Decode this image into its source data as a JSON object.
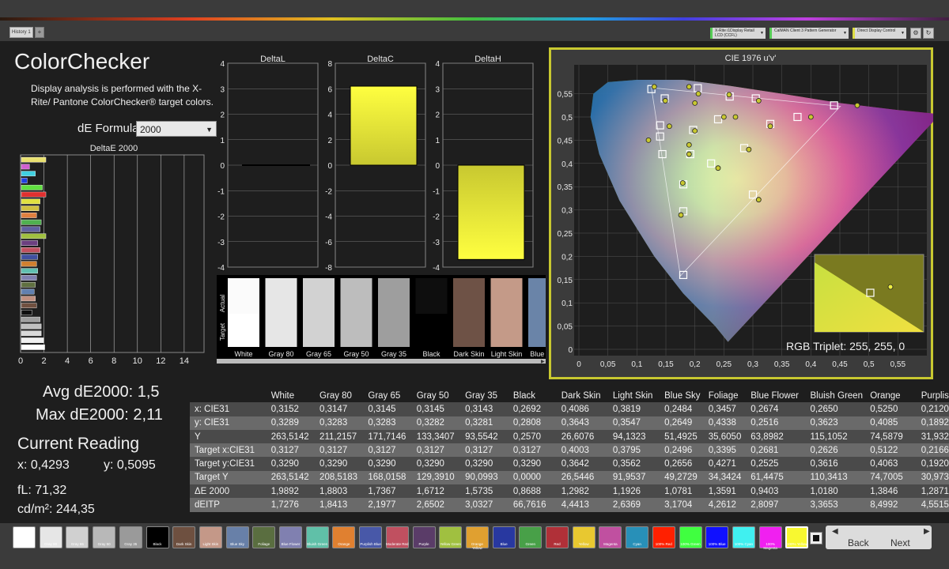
{
  "app": {
    "tab_label": "History 1",
    "dropdowns": [
      "X-Rite i1Display Retail LCD (CCFL)",
      "CalMAN Client 3 Pattern Generator",
      "Direct Display Control"
    ]
  },
  "page": {
    "title": "ColorChecker",
    "description": "Display analysis is performed with the X-Rite/ Pantone ColorChecker® target colors.",
    "formula_label": "dE Formula:",
    "formula_value": "2000"
  },
  "deltae_chart": {
    "title": "DeltaE 2000",
    "xticks": [
      "0",
      "2",
      "4",
      "6",
      "8",
      "10",
      "12",
      "14"
    ],
    "bars": [
      {
        "value": 2.1,
        "color": "#e8e070"
      },
      {
        "value": 0.7,
        "color": "#d060d0"
      },
      {
        "value": 1.2,
        "color": "#40d0e0"
      },
      {
        "value": 0.5,
        "color": "#2040e0"
      },
      {
        "value": 1.8,
        "color": "#60e040"
      },
      {
        "value": 2.1,
        "color": "#e03030"
      },
      {
        "value": 1.6,
        "color": "#e0e040"
      },
      {
        "value": 1.5,
        "color": "#d0c040"
      },
      {
        "value": 1.3,
        "color": "#e08040"
      },
      {
        "value": 1.7,
        "color": "#50b050"
      },
      {
        "value": 1.6,
        "color": "#6060a0"
      },
      {
        "value": 2.1,
        "color": "#a0c040"
      },
      {
        "value": 1.4,
        "color": "#6b3f7f"
      },
      {
        "value": 1.6,
        "color": "#c05060"
      },
      {
        "value": 1.4,
        "color": "#4050a0"
      },
      {
        "value": 1.3,
        "color": "#d08030"
      },
      {
        "value": 1.4,
        "color": "#60c0b0"
      },
      {
        "value": 1.3,
        "color": "#8080b0"
      },
      {
        "value": 1.2,
        "color": "#607040"
      },
      {
        "value": 1.1,
        "color": "#6080b0"
      },
      {
        "value": 1.2,
        "color": "#c09080"
      },
      {
        "value": 1.3,
        "color": "#705040"
      },
      {
        "value": 0.9,
        "color": "#101010"
      },
      {
        "value": 1.6,
        "color": "#a0a0a0"
      },
      {
        "value": 1.7,
        "color": "#c0c0c0"
      },
      {
        "value": 1.7,
        "color": "#d8d8d8"
      },
      {
        "value": 1.9,
        "color": "#f0f0f0"
      },
      {
        "value": 2.0,
        "color": "#ffffff"
      }
    ]
  },
  "delta_panels": [
    {
      "title": "DeltaL",
      "yticks": [
        "4",
        "3",
        "2",
        "1",
        "0",
        "-1",
        "-2",
        "-3",
        "-4"
      ],
      "ymax": 4,
      "value": 0.0
    },
    {
      "title": "DeltaC",
      "yticks": [
        "8",
        "6",
        "4",
        "2",
        "0",
        "-2",
        "-4",
        "-6",
        "-8"
      ],
      "ymax": 8,
      "value": 6.2
    },
    {
      "title": "DeltaH",
      "yticks": [
        "4",
        "3",
        "2",
        "1",
        "0",
        "-1",
        "-2",
        "-3",
        "-4"
      ],
      "ymax": 4,
      "value": -3.7
    }
  ],
  "swatch_strip": {
    "actual_label": "Actual",
    "target_label": "Target",
    "items": [
      {
        "name": "White",
        "actual": "#fbfbfb",
        "target": "#ffffff"
      },
      {
        "name": "Gray 80",
        "actual": "#e6e6e6",
        "target": "#e6e6e6"
      },
      {
        "name": "Gray 65",
        "actual": "#d2d2d2",
        "target": "#d2d2d2"
      },
      {
        "name": "Gray 50",
        "actual": "#bdbdbd",
        "target": "#bdbdbd"
      },
      {
        "name": "Gray 35",
        "actual": "#9e9e9e",
        "target": "#9e9e9e"
      },
      {
        "name": "Black",
        "actual": "#0e0e0e",
        "target": "#000000"
      },
      {
        "name": "Dark Skin",
        "actual": "#6e5246",
        "target": "#6e5246"
      },
      {
        "name": "Light Skin",
        "actual": "#c49a88",
        "target": "#c49a88"
      },
      {
        "name": "Blue Sky",
        "actual": "#6a84a8",
        "target": "#6a84a8"
      }
    ]
  },
  "cie": {
    "title": "CIE 1976 u'v'",
    "xticks": [
      "0",
      "0,05",
      "0,1",
      "0,15",
      "0,2",
      "0,25",
      "0,3",
      "0,35",
      "0,4",
      "0,45",
      "0,5",
      "0,55"
    ],
    "yticks": [
      "0,55",
      "0,5",
      "0,45",
      "0,4",
      "0,35",
      "0,3",
      "0,25",
      "0,2",
      "0,15",
      "0,1",
      "0,05",
      "0"
    ],
    "rgb_triplet": "RGB Triplet: 255, 255, 0",
    "targets": [
      [
        0.125,
        0.56
      ],
      [
        0.148,
        0.54
      ],
      [
        0.205,
        0.562
      ],
      [
        0.26,
        0.544
      ],
      [
        0.305,
        0.54
      ],
      [
        0.44,
        0.525
      ],
      [
        0.377,
        0.5
      ],
      [
        0.33,
        0.485
      ],
      [
        0.24,
        0.495
      ],
      [
        0.197,
        0.472
      ],
      [
        0.14,
        0.482
      ],
      [
        0.14,
        0.458
      ],
      [
        0.144,
        0.42
      ],
      [
        0.192,
        0.42
      ],
      [
        0.285,
        0.433
      ],
      [
        0.228,
        0.4
      ],
      [
        0.18,
        0.355
      ],
      [
        0.3,
        0.333
      ],
      [
        0.18,
        0.297
      ],
      [
        0.18,
        0.16
      ]
    ],
    "measured": [
      [
        0.13,
        0.565
      ],
      [
        0.149,
        0.535
      ],
      [
        0.206,
        0.55
      ],
      [
        0.259,
        0.548
      ],
      [
        0.31,
        0.535
      ],
      [
        0.48,
        0.525
      ],
      [
        0.4,
        0.5
      ],
      [
        0.33,
        0.48
      ],
      [
        0.25,
        0.5
      ],
      [
        0.2,
        0.47
      ],
      [
        0.156,
        0.48
      ],
      [
        0.12,
        0.45
      ],
      [
        0.19,
        0.42
      ],
      [
        0.19,
        0.44
      ],
      [
        0.293,
        0.43
      ],
      [
        0.24,
        0.39
      ],
      [
        0.179,
        0.358
      ],
      [
        0.31,
        0.322
      ],
      [
        0.176,
        0.289
      ],
      [
        0.19,
        0.565
      ],
      [
        0.2,
        0.53
      ],
      [
        0.27,
        0.5
      ]
    ]
  },
  "stats": {
    "avg": "Avg dE2000: 1,5",
    "max": "Max dE2000: 2,11",
    "current_title": "Current Reading",
    "x": "x: 0,4293",
    "y": "y: 0,5095",
    "fl": "fL: 71,32",
    "cdm2": "cd/m²: 244,35"
  },
  "table": {
    "columns": [
      "",
      "White",
      "Gray 80",
      "Gray 65",
      "Gray 50",
      "Gray 35",
      "Black",
      "Dark Skin",
      "Light Skin",
      "Blue Sky",
      "Foliage",
      "Blue Flower",
      "Bluish Green",
      "Orange",
      "Purplis"
    ],
    "rows": [
      [
        "x: CIE31",
        "0,3152",
        "0,3147",
        "0,3145",
        "0,3145",
        "0,3143",
        "0,2692",
        "0,4086",
        "0,3819",
        "0,2484",
        "0,3457",
        "0,2674",
        "0,2650",
        "0,5250",
        "0,2120"
      ],
      [
        "y: CIE31",
        "0,3289",
        "0,3283",
        "0,3283",
        "0,3282",
        "0,3281",
        "0,2808",
        "0,3643",
        "0,3547",
        "0,2649",
        "0,4338",
        "0,2516",
        "0,3623",
        "0,4085",
        "0,1892"
      ],
      [
        "Y",
        "263,5142",
        "211,2157",
        "171,7146",
        "133,3407",
        "93,5542",
        "0,2570",
        "26,6076",
        "94,1323",
        "51,4925",
        "35,6050",
        "63,8982",
        "115,1052",
        "74,5879",
        "31,932"
      ],
      [
        "Target x:CIE31",
        "0,3127",
        "0,3127",
        "0,3127",
        "0,3127",
        "0,3127",
        "0,3127",
        "0,4003",
        "0,3795",
        "0,2496",
        "0,3395",
        "0,2681",
        "0,2626",
        "0,5122",
        "0,2166"
      ],
      [
        "Target y:CIE31",
        "0,3290",
        "0,3290",
        "0,3290",
        "0,3290",
        "0,3290",
        "0,3290",
        "0,3642",
        "0,3562",
        "0,2656",
        "0,4271",
        "0,2525",
        "0,3616",
        "0,4063",
        "0,1920"
      ],
      [
        "Target Y",
        "263,5142",
        "208,5183",
        "168,0158",
        "129,3910",
        "90,0993",
        "0,0000",
        "26,5446",
        "91,9537",
        "49,2729",
        "34,3424",
        "61,4475",
        "110,3413",
        "74,7005",
        "30,973"
      ],
      [
        "ΔE 2000",
        "1,9892",
        "1,8803",
        "1,7367",
        "1,6712",
        "1,5735",
        "0,8688",
        "1,2982",
        "1,1926",
        "1,0781",
        "1,3591",
        "0,9403",
        "1,0180",
        "1,3846",
        "1,2871"
      ],
      [
        "dEITP",
        "1,7276",
        "1,8413",
        "2,1977",
        "2,6502",
        "3,0327",
        "66,7616",
        "4,4413",
        "2,6369",
        "3,1704",
        "4,2612",
        "2,8097",
        "3,3653",
        "8,4992",
        "4,5515"
      ]
    ]
  },
  "bottom_swatches": [
    {
      "label": "White",
      "color": "#ffffff"
    },
    {
      "label": "Gray 80",
      "color": "#e6e6e6"
    },
    {
      "label": "Gray 65",
      "color": "#d0d0d0"
    },
    {
      "label": "Gray 50",
      "color": "#b8b8b8"
    },
    {
      "label": "Gray 35",
      "color": "#9a9a9a"
    },
    {
      "label": "Black",
      "color": "#000000"
    },
    {
      "label": "Dark Skin",
      "color": "#6e5040"
    },
    {
      "label": "Light Skin",
      "color": "#c49888"
    },
    {
      "label": "Blue Sky",
      "color": "#6880a8"
    },
    {
      "label": "Foliage",
      "color": "#5a6e40"
    },
    {
      "label": "Blue Flower",
      "color": "#8080b0"
    },
    {
      "label": "Bluish Green",
      "color": "#60c0a8"
    },
    {
      "label": "Orange",
      "color": "#e08030"
    },
    {
      "label": "Purplish Blue",
      "color": "#4858a8"
    },
    {
      "label": "Moderate Red",
      "color": "#c05060"
    },
    {
      "label": "Purple",
      "color": "#5a3c68"
    },
    {
      "label": "Yellow Green",
      "color": "#a0c040"
    },
    {
      "label": "Orange Yellow",
      "color": "#e0a030"
    },
    {
      "label": "Blue",
      "color": "#2838a0"
    },
    {
      "label": "Green",
      "color": "#48a048"
    },
    {
      "label": "Red",
      "color": "#b03038"
    },
    {
      "label": "Yellow",
      "color": "#e8c830"
    },
    {
      "label": "Magenta",
      "color": "#c050a0"
    },
    {
      "label": "Cyan",
      "color": "#2890b8"
    },
    {
      "label": "100% Red",
      "color": "#ff2000"
    },
    {
      "label": "100% Green",
      "color": "#40ff40"
    },
    {
      "label": "100% Blue",
      "color": "#1010ff"
    },
    {
      "label": "100% Cyan",
      "color": "#40f0f0"
    },
    {
      "label": "100% Magenta",
      "color": "#f020f0"
    },
    {
      "label": "100% Yellow",
      "color": "#f8f830"
    }
  ],
  "nav": {
    "back": "Back",
    "next": "Next"
  }
}
